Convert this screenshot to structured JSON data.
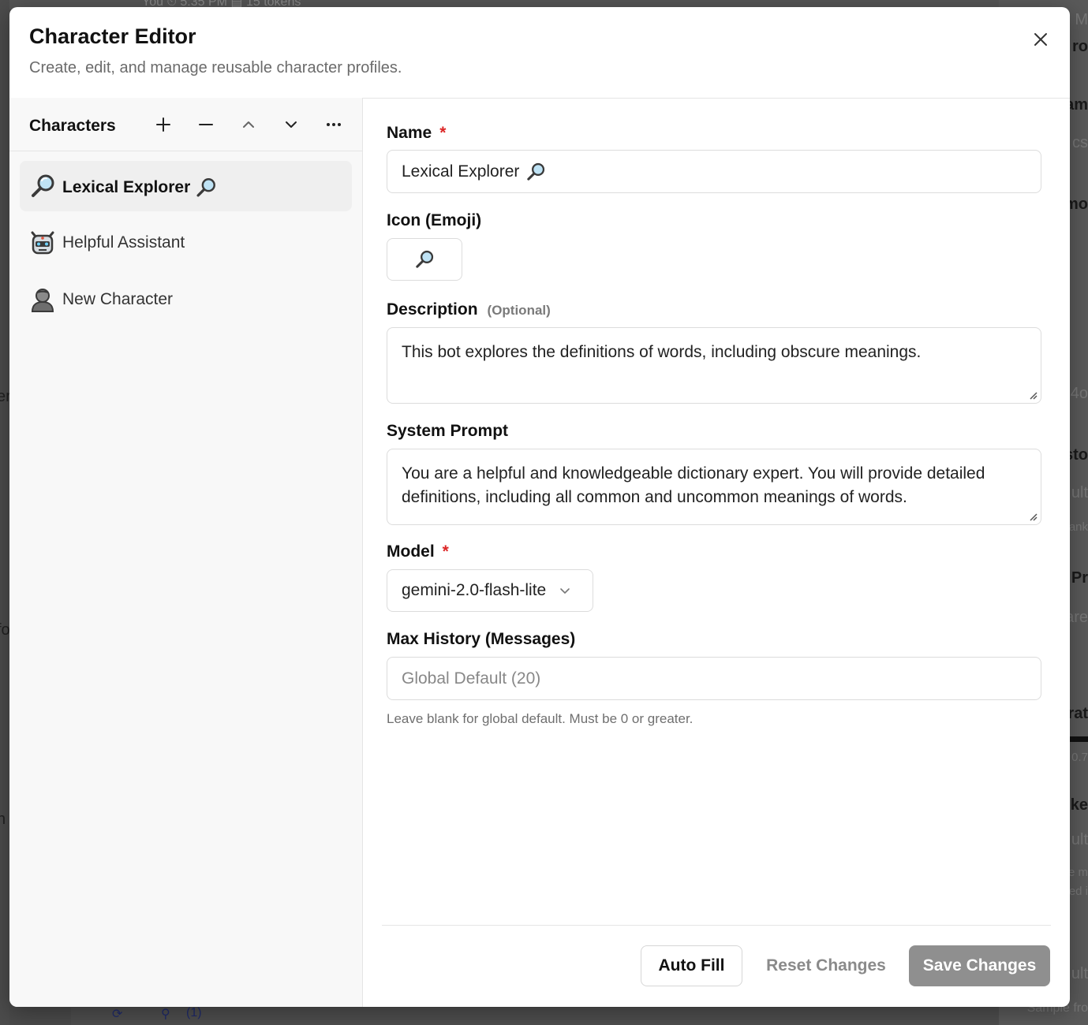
{
  "background": {
    "top_text": "You   ⏲ 5:35 PM   ▤ 15 tokens",
    "right_fragments": [
      "o M",
      "ro",
      "am",
      "cs",
      "mo",
      "4o",
      "sto",
      "ult",
      "ank",
      "Pr",
      "are",
      "rat",
      "0.7",
      "ke",
      "ult",
      "e m",
      "ed i",
      "ult",
      "Sample fro"
    ],
    "left_fragments": [
      "er",
      "fo",
      "n"
    ],
    "bottom_count": "(1)"
  },
  "modal": {
    "title": "Character Editor",
    "subtitle": "Create, edit, and manage reusable character profiles."
  },
  "sidebar": {
    "title": "Characters",
    "characters": [
      {
        "name": "Lexical Explorer",
        "icon": "magnifier-icon",
        "active": true
      },
      {
        "name": "Helpful Assistant",
        "icon": "robot-icon",
        "active": false
      },
      {
        "name": "New Character",
        "icon": "person-icon",
        "active": false
      }
    ]
  },
  "form": {
    "name_label": "Name",
    "name_required": "*",
    "name_value": "Lexical Explorer",
    "icon_label": "Icon (Emoji)",
    "icon_value": "magnifier-icon",
    "description_label": "Description",
    "description_optional": "(Optional)",
    "description_value": "This bot explores the definitions of words, including obscure meanings.",
    "system_prompt_label": "System Prompt",
    "system_prompt_value": "You are a helpful and knowledgeable dictionary expert. You will provide detailed definitions, including all common and uncommon meanings of words.",
    "model_label": "Model",
    "model_required": "*",
    "model_value": "gemini-2.0-flash-lite",
    "max_history_label": "Max History (Messages)",
    "max_history_placeholder": "Global Default (20)",
    "max_history_hint": "Leave blank for global default. Must be 0 or greater."
  },
  "footer": {
    "auto_fill": "Auto Fill",
    "reset": "Reset Changes",
    "save": "Save Changes"
  },
  "colors": {
    "required": "#dc2626",
    "save_disabled": "#8f8f8f",
    "active_item": "#efefef"
  }
}
